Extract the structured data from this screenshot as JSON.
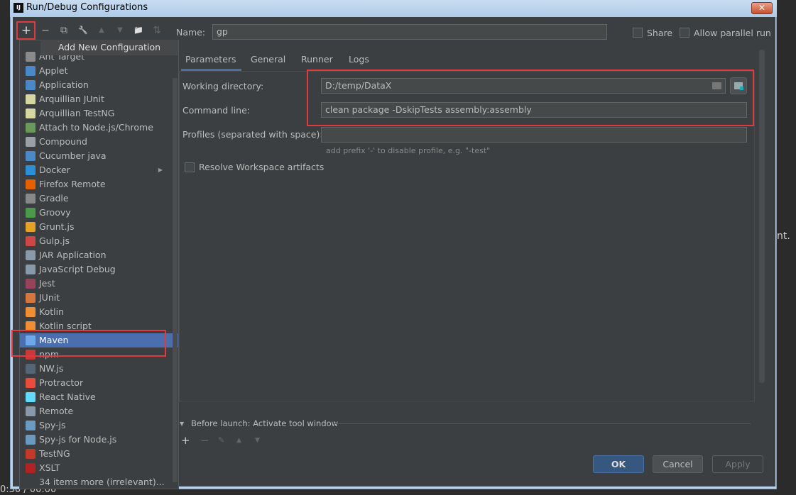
{
  "window": {
    "title": "Run/Debug Configurations",
    "app_icon": "IJ",
    "close": "✕"
  },
  "toolbar": {
    "add": "+",
    "remove": "−",
    "copy": "⧉",
    "edit": "🔧",
    "up": "▲",
    "down": "▼",
    "folder": "📁",
    "sort": "⇅"
  },
  "tooltip": "Add New Configuration",
  "name_label": "Name:",
  "name_value": "gp",
  "share_label": "Share",
  "parallel_label": "Allow parallel run",
  "tabs": [
    {
      "label": "Parameters",
      "active": true
    },
    {
      "label": "General"
    },
    {
      "label": "Runner"
    },
    {
      "label": "Logs"
    }
  ],
  "fields": {
    "working_dir_label": "Working directory:",
    "working_dir_value": "D:/temp/DataX",
    "command_label": "Command line:",
    "command_value": "clean package -DskipTests assembly:assembly",
    "profiles_label": "Profiles (separated with space):",
    "profiles_value": "",
    "profiles_hint": "add prefix '-' to disable profile, e.g. \"-test\"",
    "resolve_label": "Resolve Workspace artifacts"
  },
  "before_launch": "Before launch: Activate tool window",
  "buttons": {
    "ok": "OK",
    "cancel": "Cancel",
    "apply": "Apply"
  },
  "config_types": [
    {
      "label": "Ant Target",
      "color": "#8a8a8a"
    },
    {
      "label": "Applet",
      "color": "#4a88c7"
    },
    {
      "label": "Application",
      "color": "#4a88c7"
    },
    {
      "label": "Arquillian JUnit",
      "color": "#d6d6a0"
    },
    {
      "label": "Arquillian TestNG",
      "color": "#d6d6a0"
    },
    {
      "label": "Attach to Node.js/Chrome",
      "color": "#6a9a5a"
    },
    {
      "label": "Compound",
      "color": "#9aa0a6"
    },
    {
      "label": "Cucumber java",
      "color": "#4a88c7"
    },
    {
      "label": "Docker",
      "color": "#2d8fd5",
      "submenu": true
    },
    {
      "label": "Firefox Remote",
      "color": "#e66000"
    },
    {
      "label": "Gradle",
      "color": "#888888"
    },
    {
      "label": "Groovy",
      "color": "#4a9a4a"
    },
    {
      "label": "Grunt.js",
      "color": "#e4a125"
    },
    {
      "label": "Gulp.js",
      "color": "#cf4647"
    },
    {
      "label": "JAR Application",
      "color": "#8899aa"
    },
    {
      "label": "JavaScript Debug",
      "color": "#8899aa"
    },
    {
      "label": "Jest",
      "color": "#99425b"
    },
    {
      "label": "JUnit",
      "color": "#d5763c"
    },
    {
      "label": "Kotlin",
      "color": "#f18e33"
    },
    {
      "label": "Kotlin script",
      "color": "#f18e33"
    },
    {
      "label": "Maven",
      "color": "#6ea8e8",
      "selected": true
    },
    {
      "label": "npm",
      "color": "#cb3837"
    },
    {
      "label": "NW.js",
      "color": "#556677"
    },
    {
      "label": "Protractor",
      "color": "#e74c3c"
    },
    {
      "label": "React Native",
      "color": "#61dafb"
    },
    {
      "label": "Remote",
      "color": "#8899aa"
    },
    {
      "label": "Spy-js",
      "color": "#6a9ac0"
    },
    {
      "label": "Spy-js for Node.js",
      "color": "#6a9ac0"
    },
    {
      "label": "TestNG",
      "color": "#c0392b"
    },
    {
      "label": "XSLT",
      "color": "#b22222"
    },
    {
      "label": "34 items more (irrelevant)...",
      "color": ""
    }
  ],
  "background_text": {
    "right": "nt.",
    "bottom": "0:30 / 00:00"
  },
  "colors": {
    "accent": "#4b6eaf",
    "highlight_box": "#e0393e",
    "panel": "#3c3f41"
  }
}
